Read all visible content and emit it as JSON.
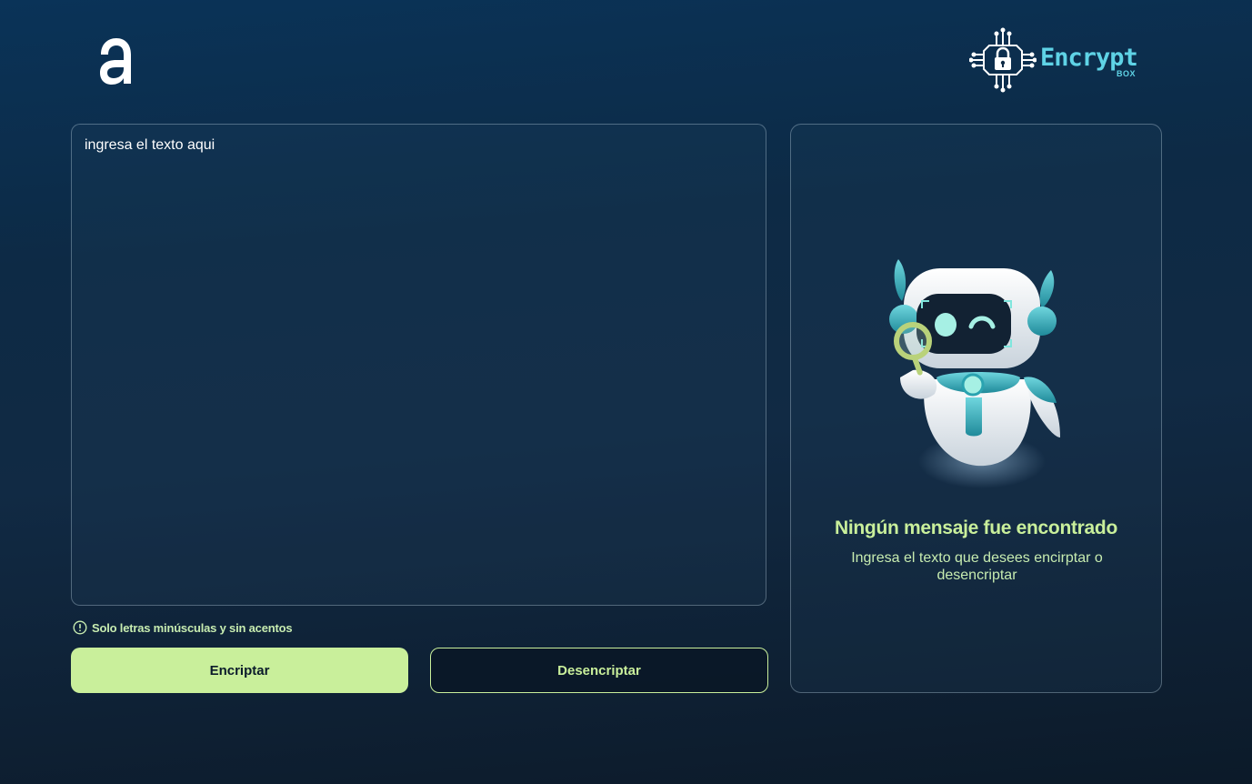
{
  "header": {
    "logo_icon": "alura-a-logo-icon",
    "brand_name": "Encrypt",
    "brand_sub": "BOX",
    "brand_icon": "circuit-lock-icon",
    "brand_color": "#5fd3e6"
  },
  "input": {
    "placeholder": "ingresa el texto aqui",
    "value": ""
  },
  "hint": {
    "icon": "exclamation-circle-icon",
    "text": "Solo letras minúsculas y sin acentos"
  },
  "actions": {
    "encrypt_label": "Encriptar",
    "decrypt_label": "Desencriptar",
    "accent_color": "#c9ef9b"
  },
  "output": {
    "illustration": "robot-magnifier-illustration",
    "title": "Ningún mensaje fue encontrado",
    "description": "Ingresa el texto que desees encirptar o desencriptar"
  }
}
